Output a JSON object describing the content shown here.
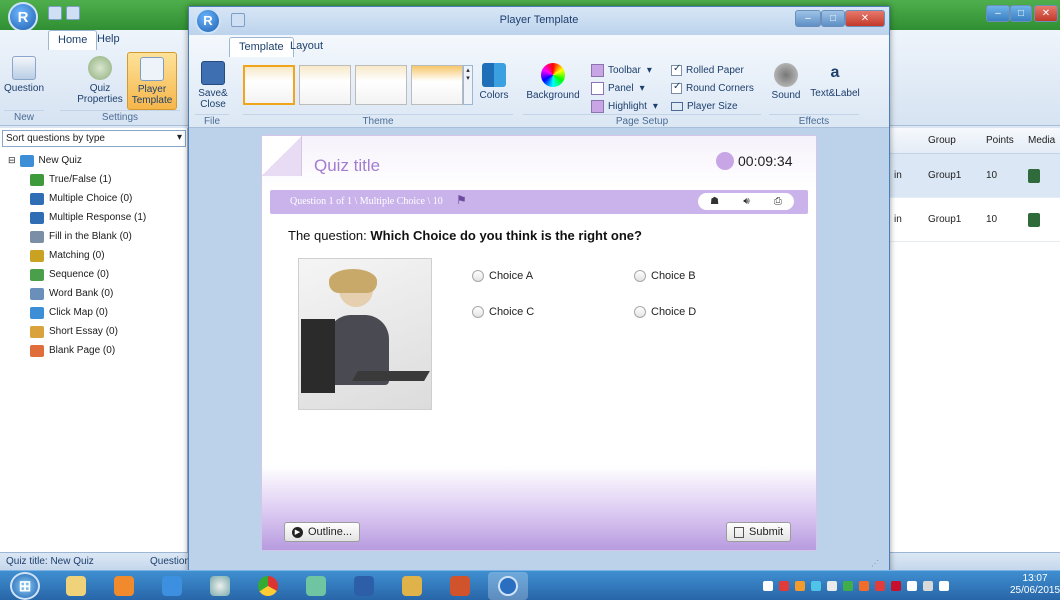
{
  "app": {
    "tabs": [
      "Home",
      "Help"
    ],
    "groups": {
      "new": "New",
      "settings": "Settings"
    },
    "buttons": {
      "question": "Question",
      "quiz_properties": "Quiz Properties",
      "player_template": "Player Template"
    },
    "sort_label": "Sort questions by type",
    "tree_root": "New Quiz",
    "tree_items": [
      {
        "label": "True/False  (1)",
        "icon": "true-false-icon",
        "color": "#3f9a3c"
      },
      {
        "label": "Multiple Choice  (0)",
        "icon": "multiple-choice-icon",
        "color": "#2f6db5"
      },
      {
        "label": "Multiple Response  (1)",
        "icon": "multiple-response-icon",
        "color": "#2f6db5"
      },
      {
        "label": "Fill in the Blank  (0)",
        "icon": "fill-blank-icon",
        "color": "#7a8ea6"
      },
      {
        "label": "Matching  (0)",
        "icon": "matching-icon",
        "color": "#c9a221"
      },
      {
        "label": "Sequence  (0)",
        "icon": "sequence-icon",
        "color": "#4aa04a"
      },
      {
        "label": "Word Bank  (0)",
        "icon": "word-bank-icon",
        "color": "#6a8fba"
      },
      {
        "label": "Click Map  (0)",
        "icon": "click-map-icon",
        "color": "#3c8fd6"
      },
      {
        "label": "Short Essay  (0)",
        "icon": "short-essay-icon",
        "color": "#d9a23c"
      },
      {
        "label": "Blank Page  (0)",
        "icon": "blank-page-icon",
        "color": "#e06e3c"
      }
    ],
    "status_left": "Quiz title: New Quiz",
    "status_right": "Questions"
  },
  "grid": {
    "columns": [
      "Group",
      "Points",
      "Media"
    ],
    "rows": [
      {
        "prefix": "in",
        "group": "Group1",
        "points": "10"
      },
      {
        "prefix": "in",
        "group": "Group1",
        "points": "10"
      }
    ]
  },
  "player_window": {
    "title": "Player Template",
    "tabs": [
      "Template",
      "Layout"
    ],
    "groups": {
      "file": "File",
      "theme": "Theme",
      "page_setup": "Page Setup",
      "effects": "Effects"
    },
    "buttons": {
      "save_close": "Save& Close",
      "colors": "Colors",
      "background": "Background",
      "sound": "Sound",
      "text_label": "Text&Label"
    },
    "setup_left": [
      {
        "label": "Toolbar",
        "color": "#c8a6e6"
      },
      {
        "label": "Panel",
        "color": "#ffffff"
      },
      {
        "label": "Highlight",
        "color": "#c8a6e6"
      }
    ],
    "setup_right": [
      {
        "label": "Rolled Paper",
        "checked": true
      },
      {
        "label": "Round Corners",
        "checked": true
      },
      {
        "label": "Player Size",
        "checked": false
      }
    ]
  },
  "quiz": {
    "title": "Quiz title",
    "timer": "00:09:34",
    "question_info": "Question 1 of 1 \\ Multiple Choice \\ 10",
    "question_prefix": "The question: ",
    "question_text": "Which Choice do you think is the right one?",
    "choices": [
      "Choice A",
      "Choice B",
      "Choice C",
      "Choice D"
    ],
    "outline": "Outline...",
    "submit": "Submit",
    "accent": "#c9b3ea"
  },
  "taskbar": {
    "time": "13:07",
    "date": "25/06/2015"
  }
}
